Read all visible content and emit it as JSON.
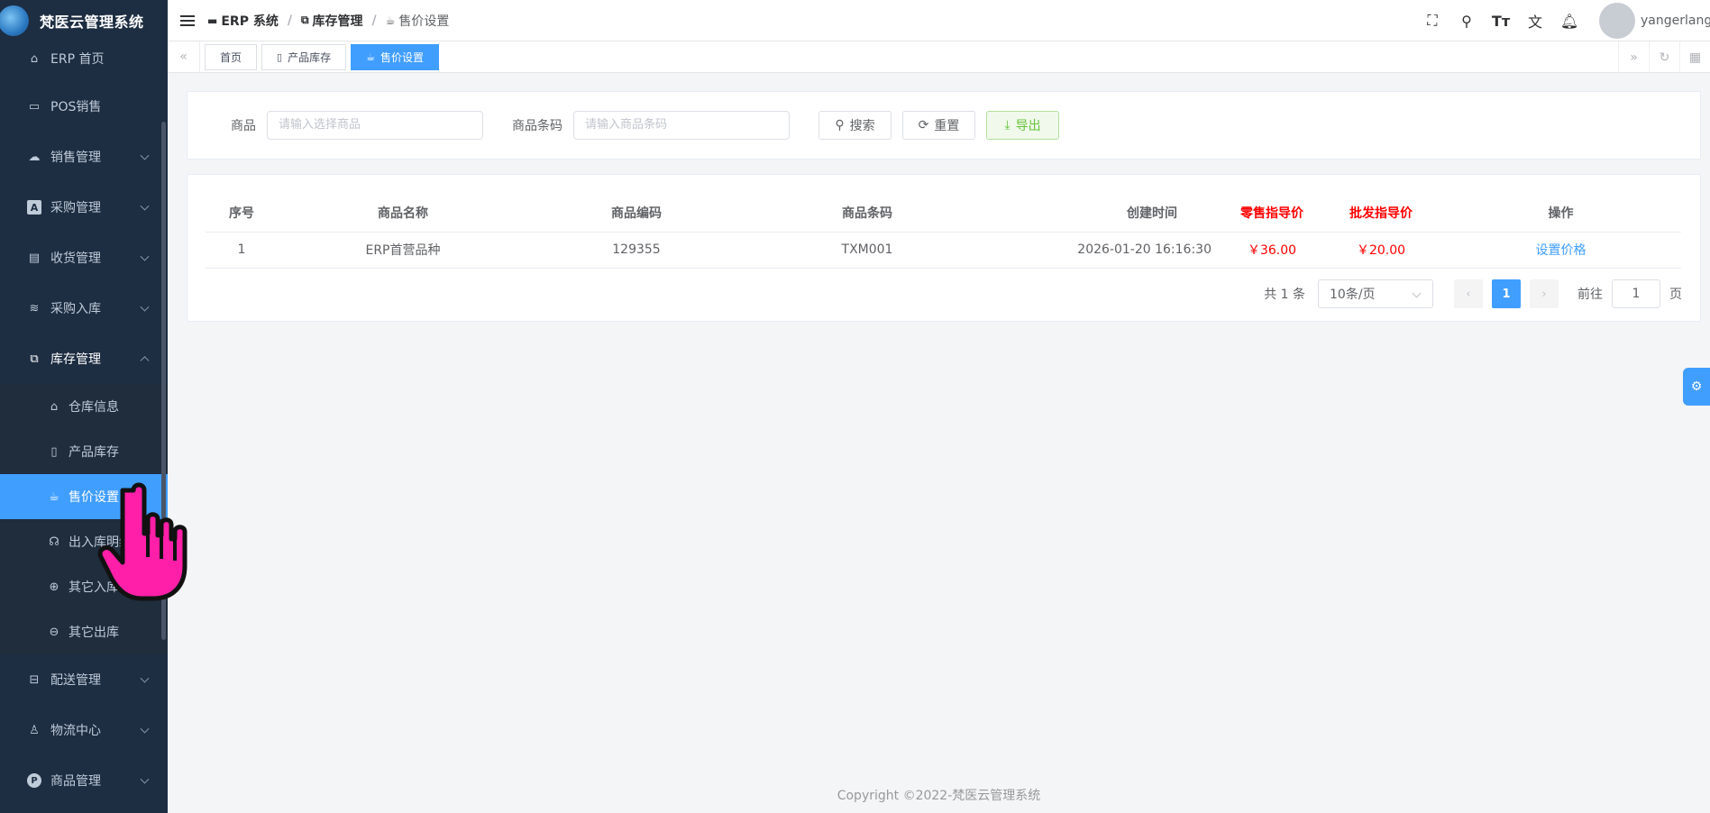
{
  "app": {
    "title": "梵医云管理系统"
  },
  "sidebar": {
    "items": [
      {
        "label": "ERP 首页",
        "icon": "home-icon"
      },
      {
        "label": "POS销售",
        "icon": "pos-icon"
      },
      {
        "label": "销售管理",
        "icon": "cloud-icon"
      },
      {
        "label": "采购管理",
        "icon": "purchase-icon"
      },
      {
        "label": "收货管理",
        "icon": "card-icon"
      },
      {
        "label": "采购入库",
        "icon": "database-icon"
      },
      {
        "label": "库存管理",
        "icon": "inventory-icon"
      }
    ],
    "sub_items": [
      {
        "label": "仓库信息",
        "icon": "house-icon"
      },
      {
        "label": "产品库存",
        "icon": "cup-icon"
      },
      {
        "label": "售价设置",
        "icon": "coffee-cup-icon"
      },
      {
        "label": "出入库明细",
        "icon": "headset-icon"
      },
      {
        "label": "其它入库",
        "icon": "zoom-in-icon"
      },
      {
        "label": "其它出库",
        "icon": "zoom-out-icon"
      }
    ],
    "bottom_items": [
      {
        "label": "配送管理",
        "icon": "box-icon"
      },
      {
        "label": "物流中心",
        "icon": "user-icon"
      },
      {
        "label": "商品管理",
        "icon": "p-circle-icon"
      }
    ]
  },
  "breadcrumb": {
    "items": [
      "ERP 系统",
      "库存管理",
      "售价设置"
    ]
  },
  "header": {
    "username": "yangerlang"
  },
  "tags": {
    "items": [
      "首页",
      "产品库存",
      "售价设置"
    ]
  },
  "search": {
    "product_label": "商品",
    "product_placeholder": "请输入选择商品",
    "barcode_label": "商品条码",
    "barcode_placeholder": "请输入商品条码",
    "search_btn": "搜索",
    "reset_btn": "重置",
    "export_btn": "导出"
  },
  "table": {
    "columns": [
      "序号",
      "商品名称",
      "商品编码",
      "商品条码",
      "创建时间",
      "零售指导价",
      "批发指导价",
      "操作"
    ],
    "rows": [
      {
        "no": "1",
        "name": "ERP首营品种",
        "code": "129355",
        "barcode": "TXM001",
        "created": "2026-01-20 16:16:30",
        "retail": "￥36.00",
        "wholesale": "￥20.00",
        "action": "设置价格"
      }
    ]
  },
  "pagination": {
    "total": "共 1 条",
    "page_size": "10条/页",
    "current_page": "1",
    "goto_label": "前往",
    "goto_value": "1",
    "page_suffix": "页"
  },
  "footer": {
    "copyright": "Copyright ©2022-梵医云管理系统"
  },
  "colors": {
    "primary": "#409eff",
    "sidebar_bg": "#1d2d42",
    "price_red": "#ff0000",
    "export_green": "#67c23a",
    "cursor_pink": "#ff1fa8"
  }
}
